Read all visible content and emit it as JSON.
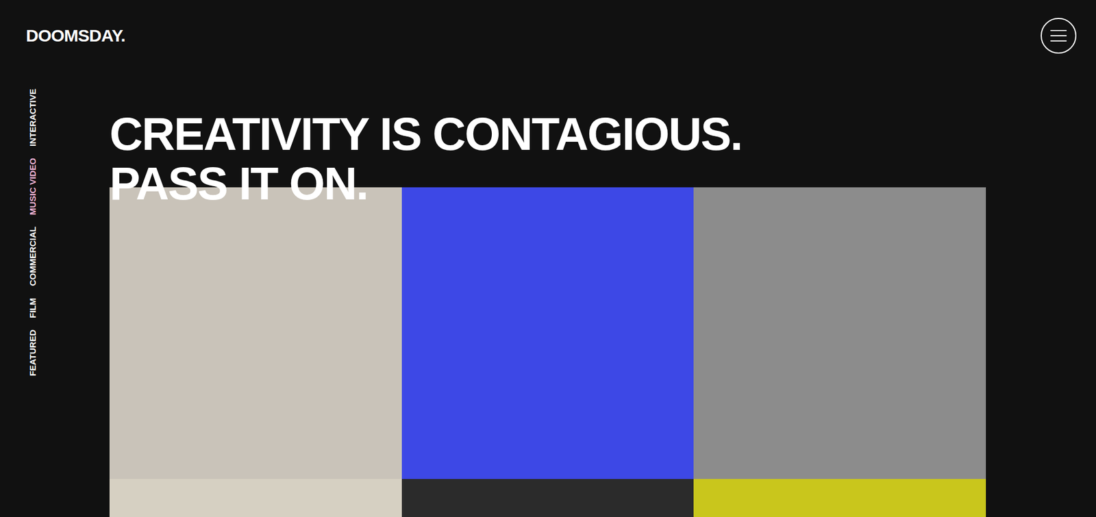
{
  "header": {
    "logo": "DOOMSDAY.",
    "menu_button": {
      "open": false
    }
  },
  "nav": {
    "items": [
      {
        "label": "INTERACTIVE",
        "selected": false
      },
      {
        "label": "MUSIC VIDEO",
        "selected": true
      },
      {
        "label": "COMMERCIAL",
        "selected": false
      },
      {
        "label": "FILM",
        "selected": false
      },
      {
        "label": "FEATURED",
        "selected": false
      }
    ]
  },
  "hero": {
    "lines": [
      "CREATIVITY IS CONTAGIOUS.",
      "PASS IT ON."
    ]
  },
  "tiles": [
    {
      "color": "#c9c3b9"
    },
    {
      "color": "#3d48e6"
    },
    {
      "color": "#8c8c8c"
    },
    {
      "color": "#d6d0c2"
    },
    {
      "color": "#2b2b2b"
    },
    {
      "color": "#c9c61c"
    }
  ]
}
